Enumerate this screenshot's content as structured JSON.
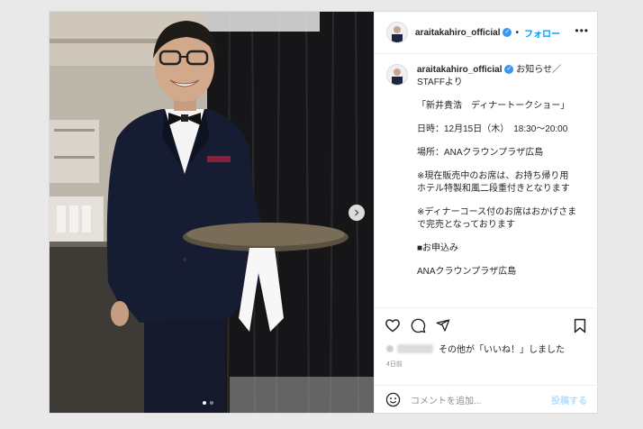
{
  "header": {
    "username": "araitakahiro_official",
    "follow_label": "フォロー",
    "more_label": "•••"
  },
  "caption": {
    "username": "araitakahiro_official",
    "lead": "お知らせ／STAFFより",
    "lines": [
      "「新井貴浩　ディナートークショー」",
      "日時：12月15日（木）　18:30～20:00",
      "場所：ANAクラウンプラザ広島",
      "※現在販売中のお席は、お持ち帰り用ホテル特製和風二段重付きとなります",
      "※ディナーコース付のお席はおかげさまで完売となっております",
      "■お申込み",
      "ANAクラウンプラザ広島"
    ]
  },
  "actions": {
    "like": "heart-icon",
    "comment": "comment-icon",
    "share": "share-icon",
    "save": "bookmark-icon"
  },
  "likes": {
    "text": "その他が「いいね！」しました",
    "lead": "その他"
  },
  "date": "4日前",
  "comment_box": {
    "placeholder": "コメントを追加...",
    "post_label": "投稿する"
  },
  "carousel": {
    "current": 1,
    "total": 2
  },
  "colors": {
    "accent": "#0095f6",
    "verified": "#3897f0",
    "post_disabled": "#b2dffc"
  }
}
